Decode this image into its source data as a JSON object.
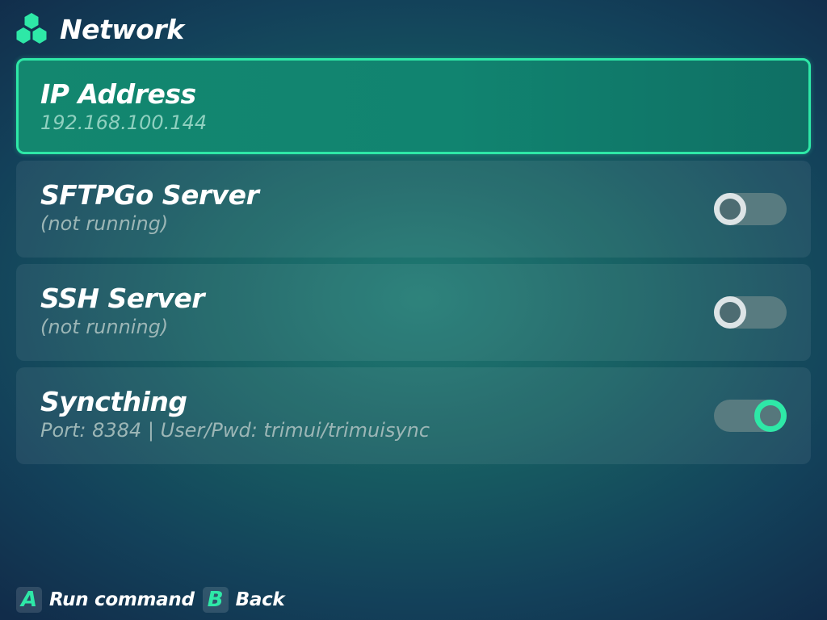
{
  "header": {
    "title": "Network",
    "icon": "hexagons-icon",
    "accent_color": "#2ee8a7"
  },
  "items": [
    {
      "title": "IP Address",
      "subtitle": "192.168.100.144",
      "selected": true
    },
    {
      "title": "SFTPGo Server",
      "subtitle": "(not running)",
      "toggle": "off"
    },
    {
      "title": "SSH Server",
      "subtitle": "(not running)",
      "toggle": "off"
    },
    {
      "title": "Syncthing",
      "subtitle": "Port: 8384 | User/Pwd: trimui/trimuisync",
      "toggle": "on"
    }
  ],
  "footer": {
    "hints": [
      {
        "key": "A",
        "label": "Run command"
      },
      {
        "key": "B",
        "label": "Back"
      }
    ]
  }
}
